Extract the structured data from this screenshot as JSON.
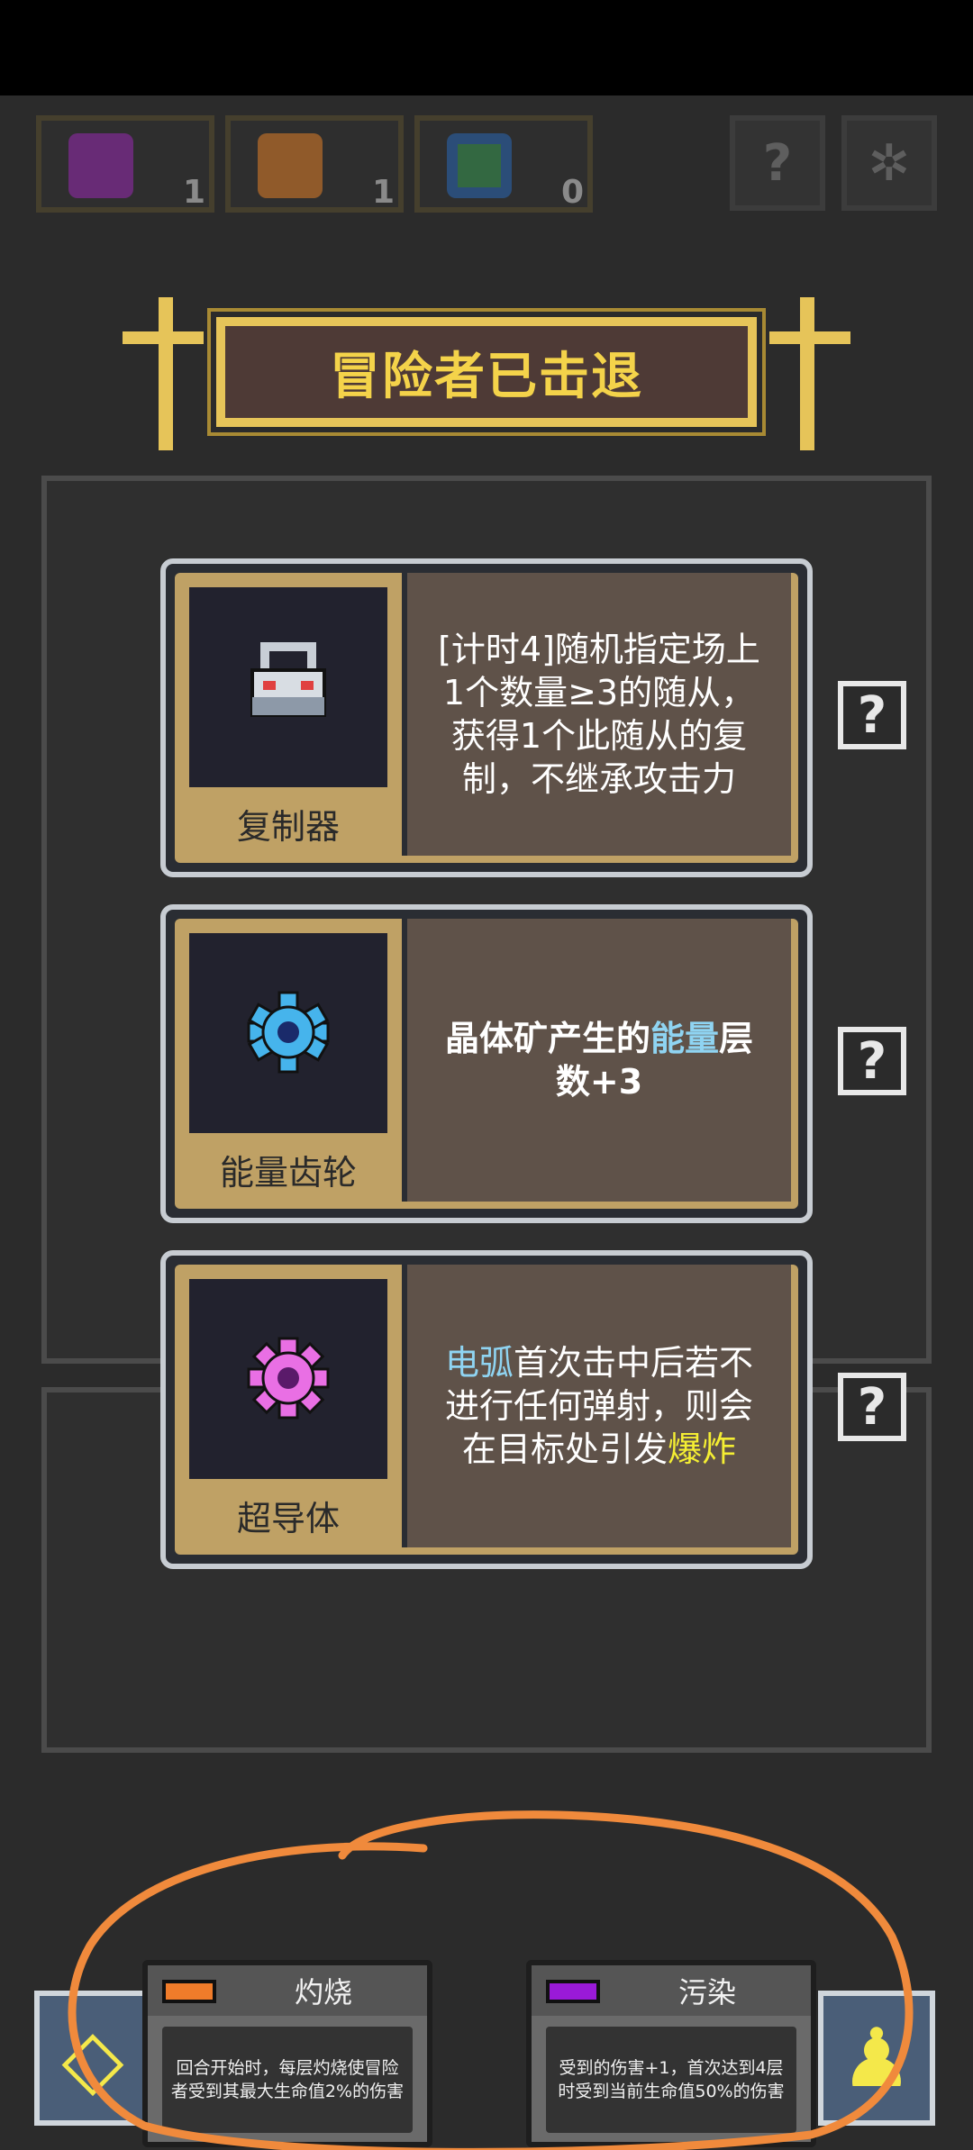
{
  "status_bar": {},
  "resources": [
    {
      "icon": "purple-skull-icon",
      "count": "1"
    },
    {
      "icon": "fire-icon",
      "count": "1"
    },
    {
      "icon": "green-ring-icon",
      "count": "0"
    }
  ],
  "top_buttons": [
    {
      "icon": "help-icon",
      "glyph": "?"
    },
    {
      "icon": "settings-icon",
      "glyph": "✲"
    }
  ],
  "banner": {
    "title": "冒险者已击退"
  },
  "cards": [
    {
      "name": "复制器",
      "icon": "duplicator-icon",
      "desc_parts": [
        {
          "text": "[计时4]随机指定场上1个数量≥3的随从，获得1个此随从的复制，不继承攻击力",
          "style": ""
        }
      ]
    },
    {
      "name": "能量齿轮",
      "icon": "blue-gear-icon",
      "desc_parts": [
        {
          "text": "晶体矿产生的",
          "style": ""
        },
        {
          "text": "能量",
          "style": "blue"
        },
        {
          "text": "层数+3",
          "style": ""
        }
      ]
    },
    {
      "name": "超导体",
      "icon": "pink-gear-icon",
      "desc_parts": [
        {
          "text": "电弧",
          "style": "blue"
        },
        {
          "text": "首次击中后若不进行任何弹射，则会在目标处引发",
          "style": ""
        },
        {
          "text": "爆炸",
          "style": "yellow"
        }
      ]
    }
  ],
  "info_buttons": [
    "?",
    "?",
    "?"
  ],
  "tooltips": [
    {
      "title": "灼烧",
      "color": "#f07c2a",
      "body": "回合开始时，每层灼烧使冒险者受到其最大生命值2%的伤害"
    },
    {
      "title": "污染",
      "color": "#9a1ad8",
      "body": "受到的伤害+1，首次达到4层时受到当前生命值50%的伤害"
    }
  ],
  "colors": {
    "accent_gold": "#e6c459",
    "annotation": "#f08a3c"
  }
}
